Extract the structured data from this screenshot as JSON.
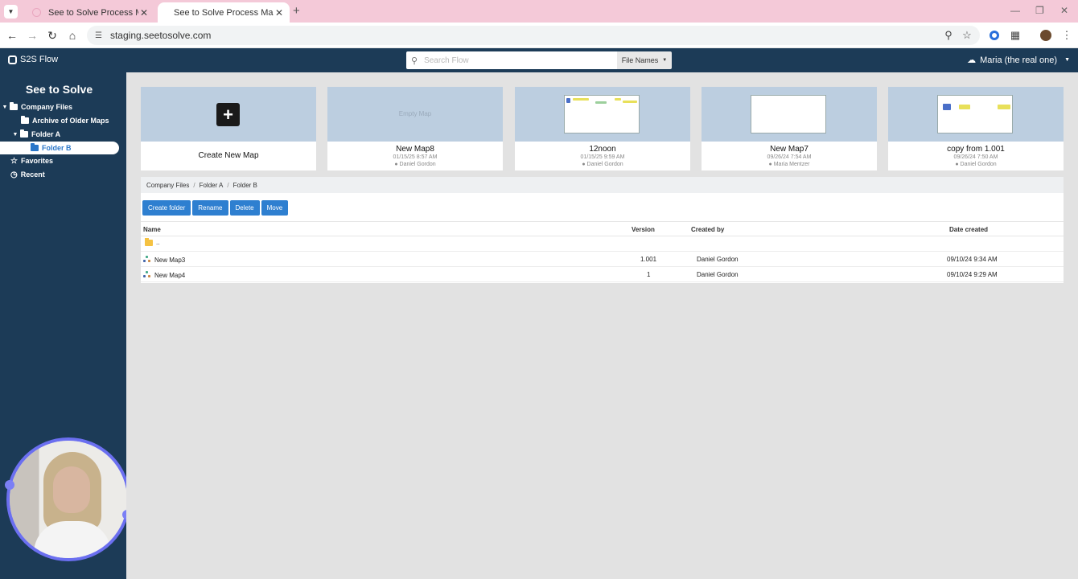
{
  "browser": {
    "tabs": [
      {
        "title": "See to Solve Process Maps",
        "active": false
      },
      {
        "title": "See to Solve Process Maps",
        "active": true
      }
    ],
    "url": "staging.seetosolve.com"
  },
  "app": {
    "brand": "S2S Flow",
    "search_placeholder": "Search Flow",
    "filter_label": "File Names",
    "user_name": "Maria (the real one)"
  },
  "sidebar": {
    "title": "See to Solve",
    "items": [
      {
        "label": "Company Files"
      },
      {
        "label": "Archive of Older Maps"
      },
      {
        "label": "Folder A"
      },
      {
        "label": "Folder B"
      },
      {
        "label": "Favorites"
      },
      {
        "label": "Recent"
      }
    ]
  },
  "cards": [
    {
      "name": "Create New Map"
    },
    {
      "name": "New Map8",
      "thumb_label": "Empty Map",
      "date": "01/15/25 8:57 AM",
      "author": "Daniel Gordon"
    },
    {
      "name": "12noon",
      "date": "01/15/25 9:59 AM",
      "author": "Daniel Gordon"
    },
    {
      "name": "New Map7",
      "date": "09/26/24 7:54 AM",
      "author": "Maria Mentzer"
    },
    {
      "name": "copy from 1.001",
      "date": "09/26/24 7:50 AM",
      "author": "Daniel Gordon"
    }
  ],
  "breadcrumb": [
    "Company Files",
    "Folder A",
    "Folder B"
  ],
  "breadcrumb_separator": "/",
  "actions": [
    "Create folder",
    "Rename",
    "Delete",
    "Move"
  ],
  "table": {
    "headers": {
      "name": "Name",
      "version": "Version",
      "created_by": "Created by",
      "date_created": "Date created"
    },
    "up_row": "..",
    "rows": [
      {
        "name": "New Map3",
        "version": "1.001",
        "created_by": "Daniel Gordon",
        "date_created": "09/10/24 9:34 AM"
      },
      {
        "name": "New Map4",
        "version": "1",
        "created_by": "Daniel Gordon",
        "date_created": "09/10/24 9:29 AM"
      }
    ]
  },
  "colors": {
    "nav_bg": "#1c3b57",
    "accent": "#2e7fd0",
    "thumb_bg": "#bccee0",
    "tabbar_bg": "#f4c9d8"
  }
}
